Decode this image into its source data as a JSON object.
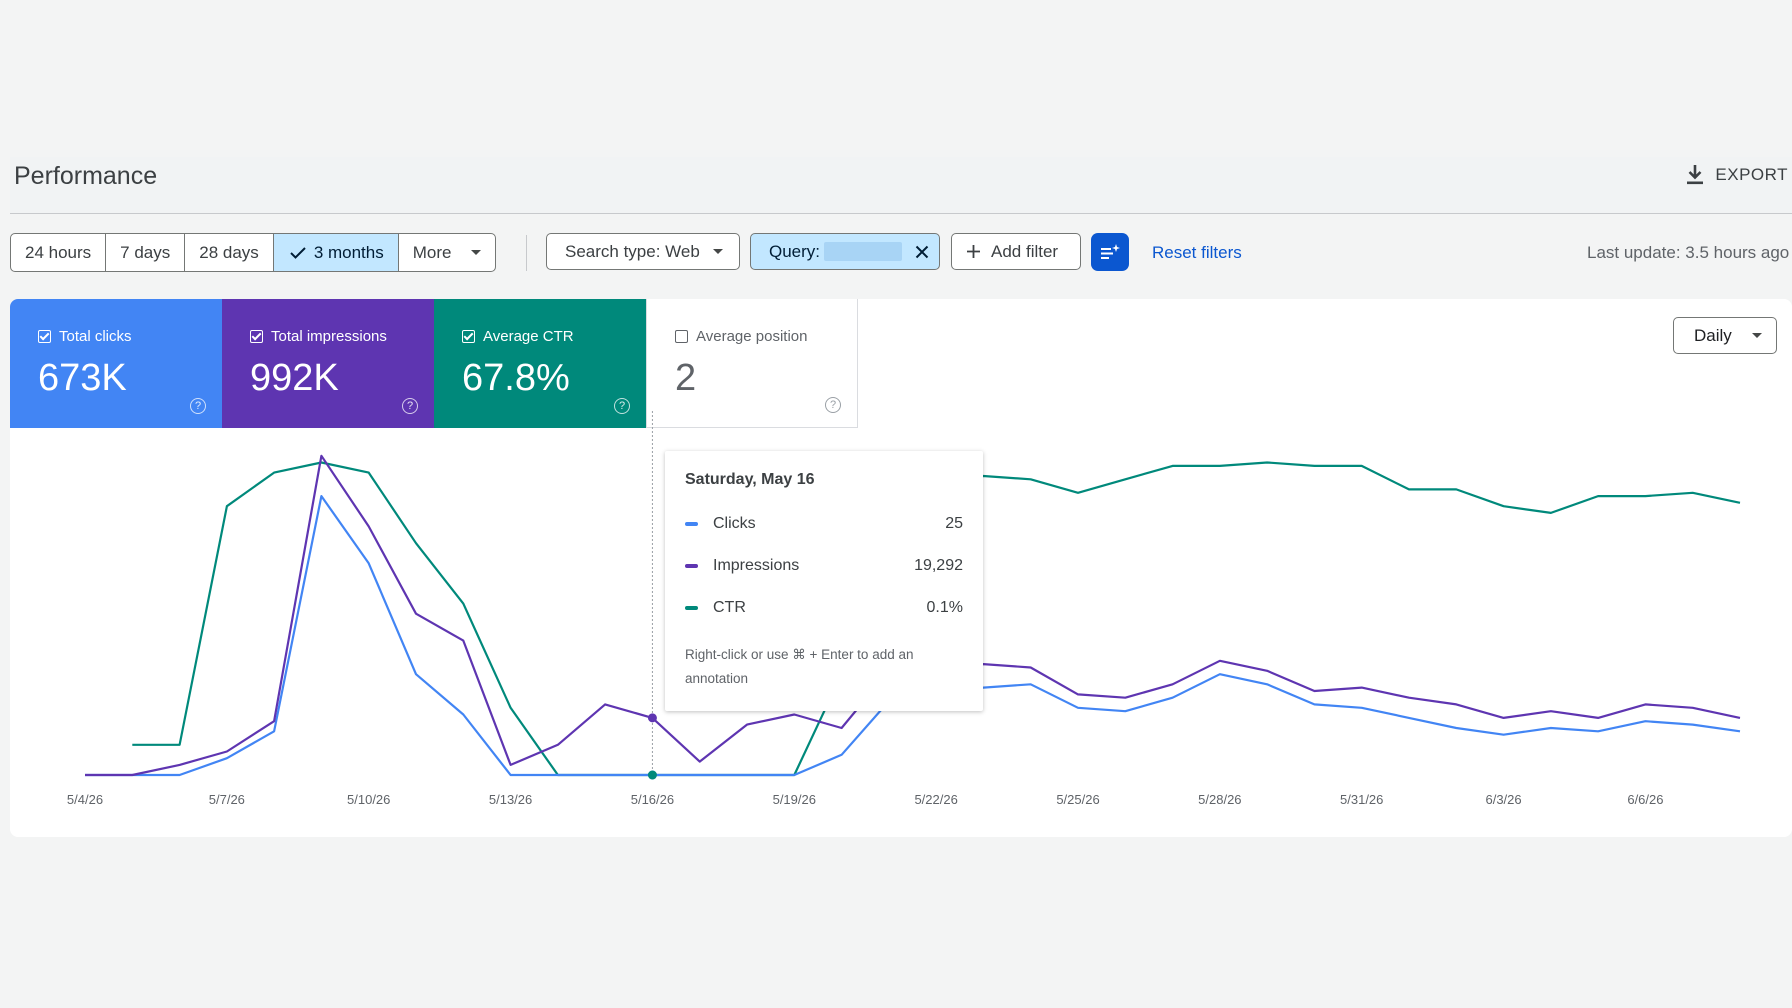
{
  "header": {
    "title": "Performance",
    "export_label": "EXPORT"
  },
  "date_range": {
    "options": [
      "24 hours",
      "7 days",
      "28 days",
      "3 months",
      "More"
    ],
    "selected": "3 months"
  },
  "filters": {
    "search_type": "Search type: Web",
    "query_label": "Query:",
    "add_filter": "Add filter",
    "reset": "Reset filters",
    "last_update": "Last update: 3.5 hours ago"
  },
  "metrics": [
    {
      "label": "Total clicks",
      "value": "673K",
      "checked": true,
      "color": "#4285f4"
    },
    {
      "label": "Total impressions",
      "value": "992K",
      "checked": true,
      "color": "#5e35b1"
    },
    {
      "label": "Average CTR",
      "value": "67.8%",
      "checked": true,
      "color": "#00897b"
    },
    {
      "label": "Average position",
      "value": "2",
      "checked": false,
      "color": "#ffffff"
    }
  ],
  "granularity": "Daily",
  "tooltip": {
    "date": "Saturday, May 16",
    "rows": [
      {
        "name": "Clicks",
        "value": "25",
        "color": "#4285f4"
      },
      {
        "name": "Impressions",
        "value": "19,292",
        "color": "#5e35b1"
      },
      {
        "name": "CTR",
        "value": "0.1%",
        "color": "#00897b"
      }
    ],
    "note": "Right-click or use ⌘ + Enter to add an annotation"
  },
  "chart_data": {
    "type": "line",
    "x": [
      "5/4/26",
      "5/5/26",
      "5/6/26",
      "5/7/26",
      "5/8/26",
      "5/9/26",
      "5/10/26",
      "5/11/26",
      "5/12/26",
      "5/13/26",
      "5/14/26",
      "5/15/26",
      "5/16/26",
      "5/17/26",
      "5/18/26",
      "5/19/26",
      "5/20/26",
      "5/21/26",
      "5/22/26",
      "5/23/26",
      "5/24/26",
      "5/25/26",
      "5/26/26",
      "5/27/26",
      "5/28/26",
      "5/29/26",
      "5/30/26",
      "5/31/26",
      "6/1/26",
      "6/2/26",
      "6/3/26",
      "6/4/26",
      "6/5/26",
      "6/6/26",
      "6/7/26",
      "6/8/26"
    ],
    "x_ticks": [
      "5/4/26",
      "5/7/26",
      "5/10/26",
      "5/13/26",
      "5/16/26",
      "5/19/26",
      "5/22/26",
      "5/25/26",
      "5/28/26",
      "5/31/26",
      "6/3/26",
      "6/6/26"
    ],
    "y_range_note": "independent normalized scales per series (0–100), no axis shown",
    "ylim": [
      0,
      100
    ],
    "highlight_x": "5/16/26",
    "series": [
      {
        "name": "Clicks",
        "color": "#4285f4",
        "values": [
          0,
          0,
          0,
          5,
          13,
          83,
          63,
          30,
          18,
          0,
          0,
          0,
          0,
          0,
          0,
          0,
          6,
          22,
          24,
          26,
          27,
          20,
          19,
          23,
          30,
          27,
          21,
          20,
          17,
          14,
          12,
          14,
          13,
          16,
          15,
          13
        ]
      },
      {
        "name": "Impressions",
        "color": "#5e35b1",
        "values": [
          0,
          0,
          3,
          7,
          16,
          95,
          74,
          48,
          40,
          3,
          9,
          21,
          17,
          4,
          15,
          18,
          14,
          31,
          31,
          33,
          32,
          24,
          23,
          27,
          34,
          31,
          25,
          26,
          23,
          21,
          17,
          19,
          17,
          21,
          20,
          17
        ]
      },
      {
        "name": "CTR",
        "color": "#00897b",
        "values": [
          null,
          9,
          9,
          80,
          90,
          93,
          90,
          69,
          51,
          20,
          0,
          0,
          0,
          0,
          0,
          0,
          30,
          53,
          87,
          89,
          88,
          84,
          88,
          92,
          92,
          93,
          92,
          92,
          85,
          85,
          80,
          78,
          83,
          83,
          84,
          81
        ]
      }
    ]
  }
}
